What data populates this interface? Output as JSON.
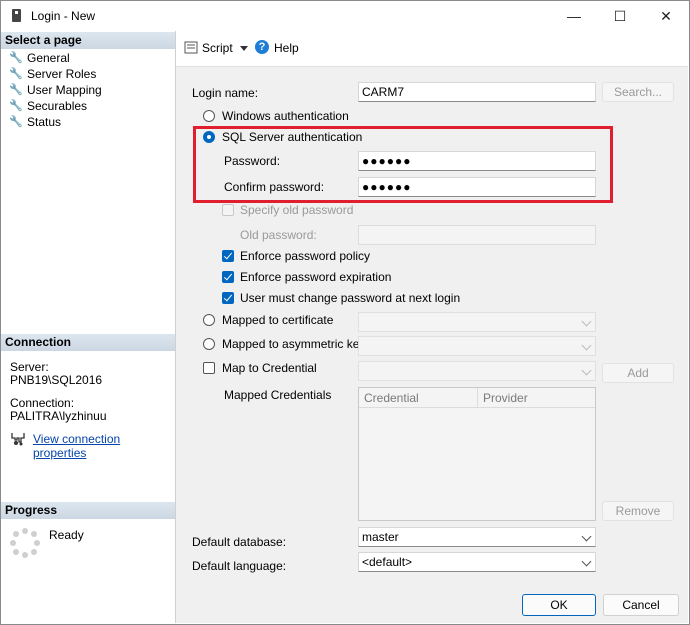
{
  "window": {
    "title": "Login - New",
    "minimize_glyph": "—",
    "maximize_glyph": "☐",
    "close_glyph": "✕"
  },
  "sidebar": {
    "select_page_header": "Select a page",
    "pages": [
      {
        "label": "General",
        "icon": "wrench-icon"
      },
      {
        "label": "Server Roles",
        "icon": "wrench-icon"
      },
      {
        "label": "User Mapping",
        "icon": "wrench-icon"
      },
      {
        "label": "Securables",
        "icon": "wrench-icon"
      },
      {
        "label": "Status",
        "icon": "wrench-icon"
      }
    ],
    "connection_header": "Connection",
    "server_label": "Server:",
    "server_value": "PNB19\\SQL2016",
    "connection_label": "Connection:",
    "connection_value": "PALITRA\\lyzhinuu",
    "view_props_link": "View connection properties",
    "progress_header": "Progress",
    "progress_status": "Ready"
  },
  "toolbar": {
    "script_label": "Script",
    "help_label": "Help"
  },
  "form": {
    "login_name_label": "Login name:",
    "login_name_value": "CARM7",
    "search_button": "Search...",
    "windows_auth": "Windows authentication",
    "sql_auth": "SQL Server authentication",
    "password_label": "Password:",
    "password_value": "●●●●●●",
    "confirm_label": "Confirm password:",
    "confirm_value": "●●●●●●",
    "specify_old": "Specify old password",
    "old_password_label": "Old password:",
    "enforce_policy": "Enforce password policy",
    "enforce_expiration": "Enforce password expiration",
    "must_change": "User must change password at next login",
    "mapped_cert": "Mapped to certificate",
    "mapped_asym": "Mapped to asymmetric key",
    "map_credential": "Map to Credential",
    "add_button": "Add",
    "mapped_credentials_label": "Mapped Credentials",
    "grid_cols": [
      "Credential",
      "Provider"
    ],
    "remove_button": "Remove",
    "default_db_label": "Default database:",
    "default_db_value": "master",
    "default_lang_label": "Default language:",
    "default_lang_value": "<default>"
  },
  "footer": {
    "ok": "OK",
    "cancel": "Cancel"
  },
  "colors": {
    "accent": "#0067c0",
    "highlight_box": "#e01e2e",
    "section_header": "#d3dde8"
  }
}
